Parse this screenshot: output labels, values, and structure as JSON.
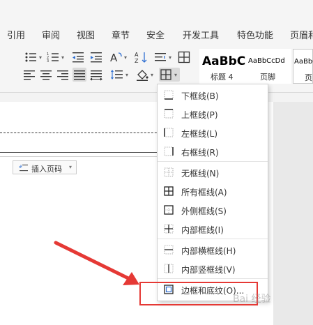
{
  "menubar": {
    "tabs": [
      "引用",
      "审阅",
      "视图",
      "章节",
      "安全",
      "开发工具",
      "特色功能",
      "页眉和"
    ]
  },
  "ribbon": {
    "icons": [
      "bullet-list-icon",
      "numbered-list-icon",
      "decrease-indent-icon",
      "increase-indent-icon",
      "text-direction-icon",
      "sort-icon",
      "line-spacing-icon",
      "table-grid-icon",
      "align-left-icon",
      "align-center-icon",
      "align-right-icon",
      "justify-icon",
      "distribute-icon",
      "paragraph-spacing-icon",
      "shading-icon",
      "borders-icon"
    ]
  },
  "styles": {
    "items": [
      {
        "preview": "AaBbC",
        "name": "标题 4"
      },
      {
        "preview": "AaBbCcDd",
        "name": "页脚"
      },
      {
        "preview": "AaBbCc",
        "name": "页"
      }
    ]
  },
  "document": {
    "insert_page_number": "插入页码"
  },
  "border_menu": {
    "items": [
      {
        "label": "下框线(B)",
        "icon": "bottom-border-icon"
      },
      {
        "label": "上框线(P)",
        "icon": "top-border-icon"
      },
      {
        "label": "左框线(L)",
        "icon": "left-border-icon"
      },
      {
        "label": "右框线(R)",
        "icon": "right-border-icon"
      },
      {
        "label": "无框线(N)",
        "icon": "no-border-icon"
      },
      {
        "label": "所有框线(A)",
        "icon": "all-borders-icon"
      },
      {
        "label": "外侧框线(S)",
        "icon": "outside-borders-icon"
      },
      {
        "label": "内部框线(I)",
        "icon": "inside-borders-icon"
      },
      {
        "label": "内部横框线(H)",
        "icon": "inside-horizontal-border-icon"
      },
      {
        "label": "内部竖框线(V)",
        "icon": "inside-vertical-border-icon"
      },
      {
        "label": "边框和底纹(O)...",
        "icon": "borders-and-shading-icon"
      }
    ]
  },
  "annotation": {
    "highlight_color": "#e53935"
  },
  "watermark": {
    "text": "Bai 经验"
  }
}
